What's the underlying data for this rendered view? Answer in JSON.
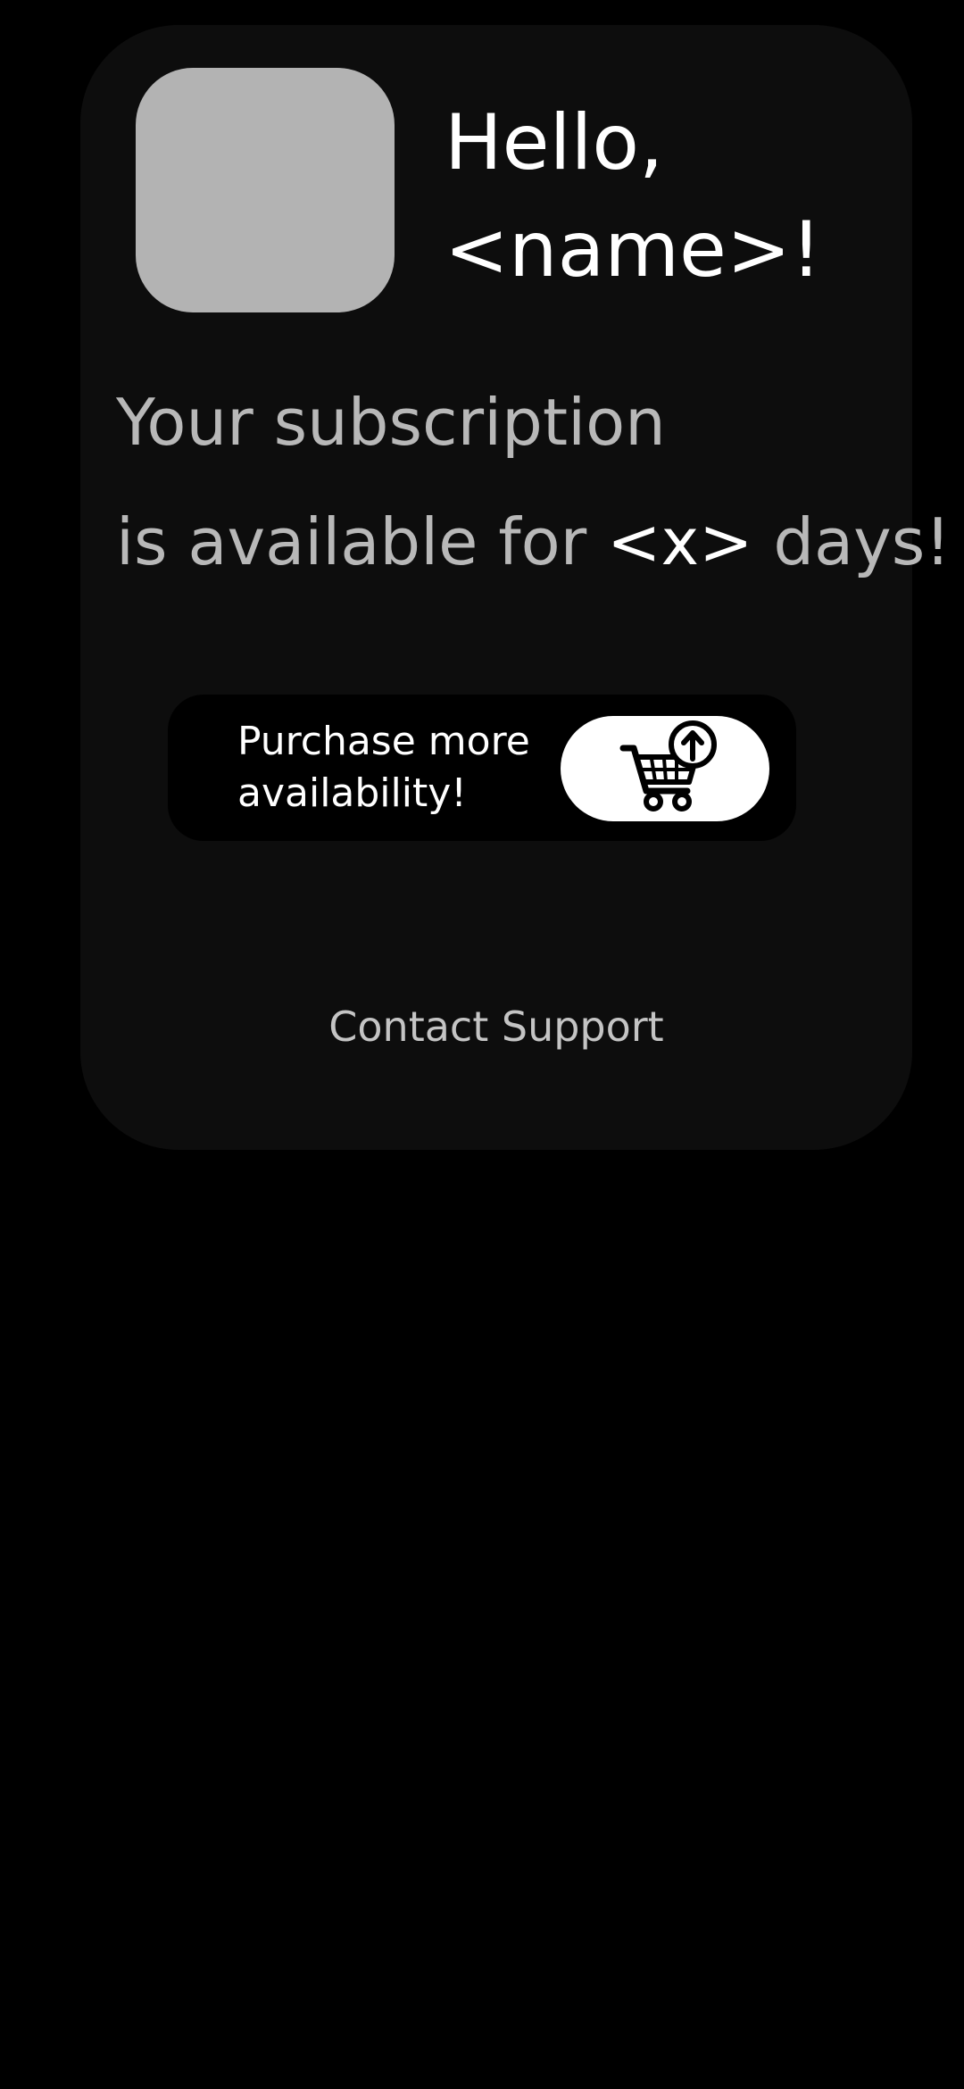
{
  "profile": {
    "greeting_line1": "Hello,",
    "greeting_line2": "<name>!"
  },
  "subscription": {
    "line1": "Your subscription",
    "line2_prefix": "is available for ",
    "days_placeholder": "<x>",
    "line2_suffix": " days!"
  },
  "purchase": {
    "label_line1": "Purchase more",
    "label_line2": "availability!",
    "button_icon": "cart-upgrade-icon"
  },
  "footer": {
    "support_label": "Contact Support"
  },
  "colors": {
    "background": "#000000",
    "card": "#0d0d0d",
    "avatar_placeholder": "#b3b3b3",
    "primary_text": "#ffffff",
    "secondary_text": "#b8b8b8"
  }
}
